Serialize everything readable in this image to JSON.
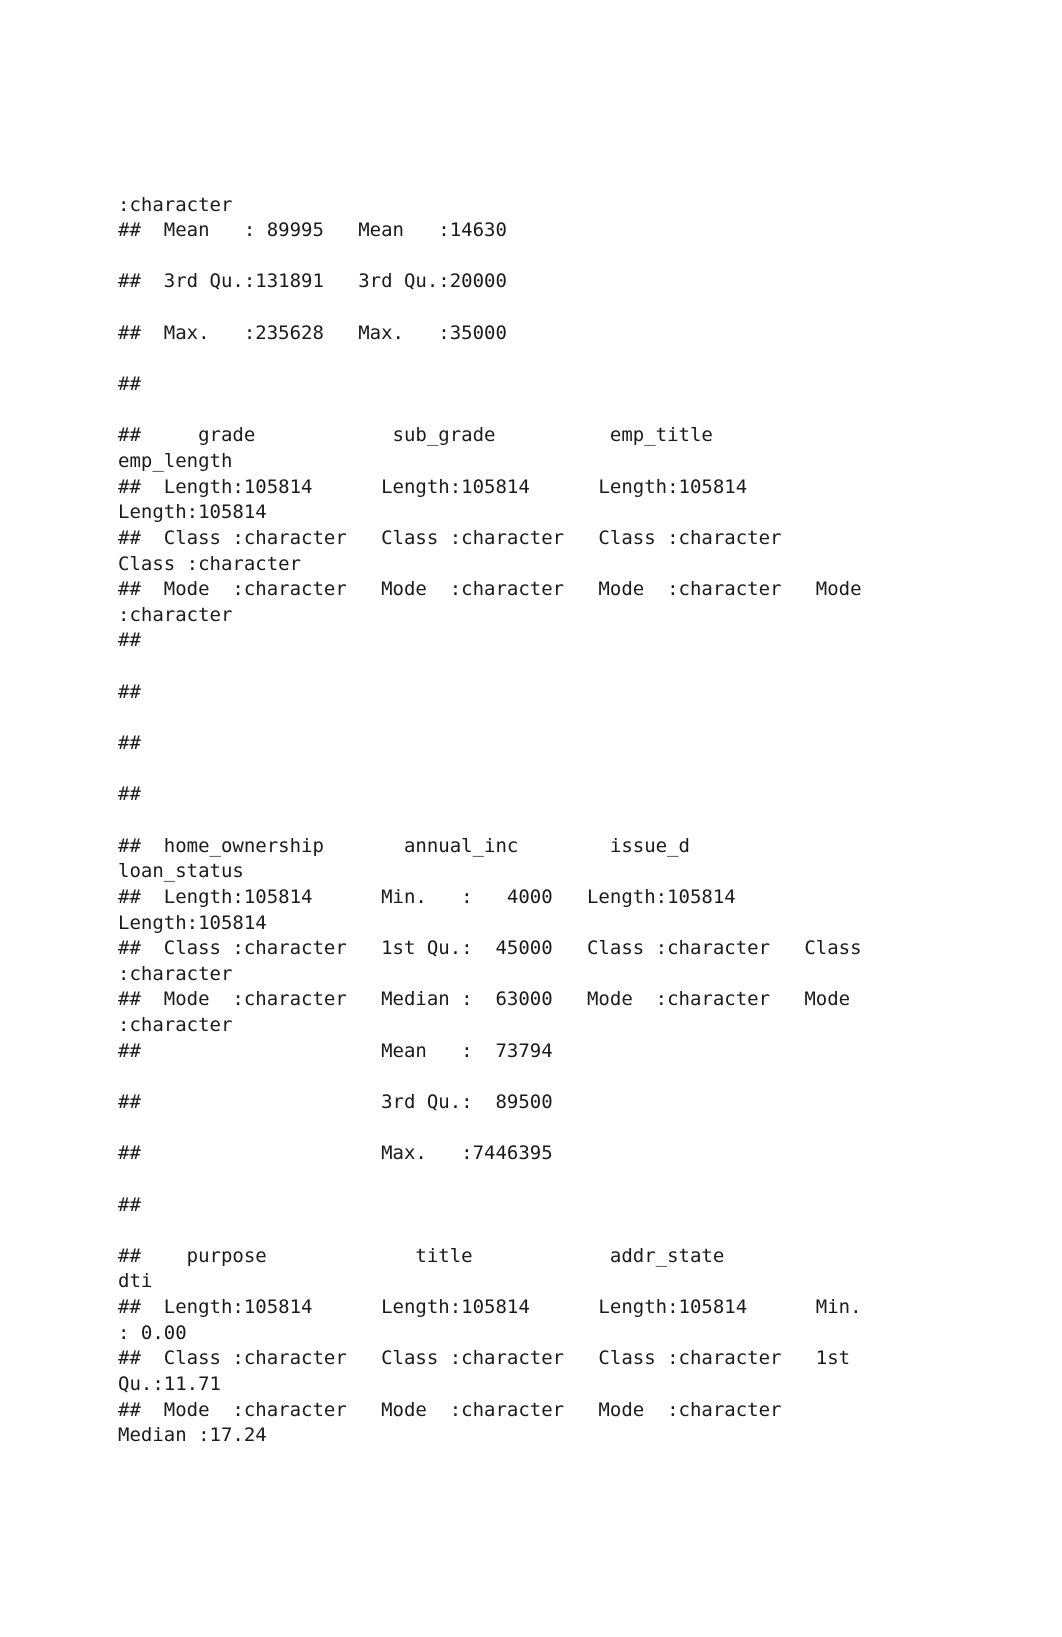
{
  "lines": [
    ":character                                                              ",
    "##  Mean   : 89995   Mean   :14630                                      ",
    "",
    "##  3rd Qu.:131891   3rd Qu.:20000                                      ",
    "",
    "##  Max.   :235628   Max.   :35000                                      ",
    "",
    "##                                                                      ",
    "",
    "##     grade            sub_grade          emp_title         ",
    "emp_length       ",
    "##  Length:105814      Length:105814      Length:105814      ",
    "Length:105814     ",
    "##  Class :character   Class :character   Class :character   ",
    "Class :character  ",
    "##  Mode  :character   Mode  :character   Mode  :character   Mode  ",
    ":character  ",
    "##                                                                      ",
    "",
    "##                                                                      ",
    "",
    "##                                                                      ",
    "",
    "##                                                                      ",
    "",
    "##  home_ownership       annual_inc        issue_d          ",
    "loan_status       ",
    "##  Length:105814      Min.   :   4000   Length:105814      ",
    "Length:105814     ",
    "##  Class :character   1st Qu.:  45000   Class :character   Class ",
    ":character  ",
    "##  Mode  :character   Median :  63000   Mode  :character   Mode  ",
    ":character  ",
    "##                     Mean   :  73794                               ",
    "",
    "##                     3rd Qu.:  89500                               ",
    "",
    "##                     Max.   :7446395                               ",
    "",
    "##                                                                   ",
    "",
    "##    purpose             title            addr_state             ",
    "dti       ",
    "##  Length:105814      Length:105814      Length:105814      Min.   ",
    ": 0.00  ",
    "##  Class :character   Class :character   Class :character   1st ",
    "Qu.:11.71  ",
    "##  Mode  :character   Mode  :character   Mode  :character   ",
    "Median :17.24  "
  ]
}
